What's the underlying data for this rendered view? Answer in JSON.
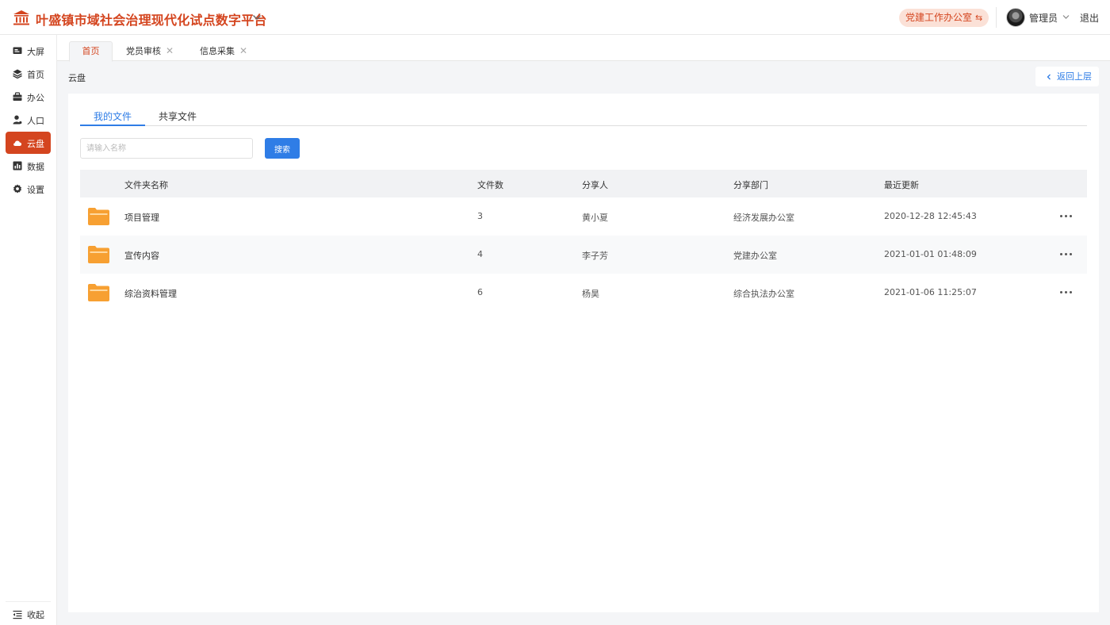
{
  "header": {
    "title": "叶盛镇市域社会治理现代化试点数字平台",
    "dept_badge": "党建工作办公室",
    "user_name": "管理员",
    "logout": "退出",
    "brand_color": "#d4451f"
  },
  "sidebar": {
    "items": [
      {
        "label": "大屏",
        "icon": "screen-icon"
      },
      {
        "label": "首页",
        "icon": "layers-icon"
      },
      {
        "label": "办公",
        "icon": "briefcase-icon"
      },
      {
        "label": "人口",
        "icon": "person-icon"
      },
      {
        "label": "云盘",
        "icon": "cloud-icon",
        "active": true
      },
      {
        "label": "数据",
        "icon": "chart-icon"
      },
      {
        "label": "设置",
        "icon": "gear-icon"
      }
    ],
    "collapse": "收起"
  },
  "tabs": [
    {
      "label": "首页",
      "active": true
    },
    {
      "label": "党员审核",
      "closable": true
    },
    {
      "label": "信息采集",
      "closable": true
    }
  ],
  "breadcrumb": "云盘",
  "back_button": "返回上层",
  "subtabs": {
    "mine": "我的文件",
    "shared": "共享文件"
  },
  "search": {
    "placeholder": "请输入名称",
    "button": "搜索"
  },
  "table": {
    "columns": {
      "name": "文件夹名称",
      "count": "文件数",
      "sharer": "分享人",
      "dept": "分享部门",
      "updated": "最近更新"
    },
    "rows": [
      {
        "name": "项目管理",
        "count": "3",
        "sharer": "黄小夏",
        "dept": "经济发展办公室",
        "updated": "2020-12-28 12:45:43"
      },
      {
        "name": "宣传内容",
        "count": "4",
        "sharer": "李子芳",
        "dept": "党建办公室",
        "updated": "2021-01-01 01:48:09"
      },
      {
        "name": "综治资料管理",
        "count": "6",
        "sharer": "杨昊",
        "dept": "综合执法办公室",
        "updated": "2021-01-06 11:25:07"
      }
    ]
  },
  "colors": {
    "accent": "#d4451f",
    "link": "#2f7de6",
    "folder": "#f7a032"
  }
}
